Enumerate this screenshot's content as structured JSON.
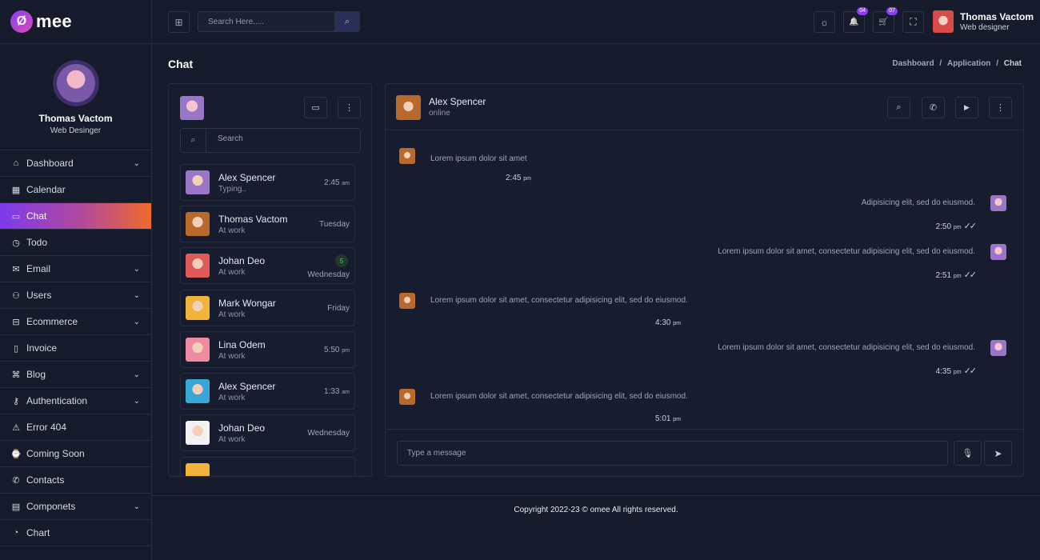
{
  "brand": {
    "logo_glyph": "Ø",
    "name": "mee"
  },
  "profile": {
    "name": "Thomas Vactom",
    "role": "Web Desinger"
  },
  "sidebar": {
    "items": [
      {
        "label": "Dashboard",
        "icon": "home-icon",
        "glyph": "⌂",
        "chevron": true
      },
      {
        "label": "Calendar",
        "icon": "calendar-icon",
        "glyph": "▦",
        "chevron": false
      },
      {
        "label": "Chat",
        "icon": "chat-icon",
        "glyph": "▭",
        "chevron": false,
        "active": true
      },
      {
        "label": "Todo",
        "icon": "clock-icon",
        "glyph": "◷",
        "chevron": false
      },
      {
        "label": "Email",
        "icon": "mail-icon",
        "glyph": "✉",
        "chevron": true
      },
      {
        "label": "Users",
        "icon": "user-icon",
        "glyph": "⚇",
        "chevron": true
      },
      {
        "label": "Ecommerce",
        "icon": "bag-icon",
        "glyph": "⊟",
        "chevron": true
      },
      {
        "label": "Invoice",
        "icon": "file-icon",
        "glyph": "▯",
        "chevron": false
      },
      {
        "label": "Blog",
        "icon": "command-icon",
        "glyph": "⌘",
        "chevron": true
      },
      {
        "label": "Authentication",
        "icon": "key-icon",
        "glyph": "⚷",
        "chevron": true
      },
      {
        "label": "Error 404",
        "icon": "alert-icon",
        "glyph": "⚠",
        "chevron": false
      },
      {
        "label": "Coming Soon",
        "icon": "watch-icon",
        "glyph": "⌚",
        "chevron": false
      },
      {
        "label": "Contacts",
        "icon": "phone-icon",
        "glyph": "✆",
        "chevron": false
      },
      {
        "label": "Componets",
        "icon": "layout-icon",
        "glyph": "▤",
        "chevron": true
      },
      {
        "label": "Chart",
        "icon": "pie-chart-icon",
        "glyph": "◔",
        "chevron": false
      }
    ],
    "chevron_glyph": "⌄"
  },
  "topbar": {
    "search_placeholder": "Search Here.....",
    "grid_glyph": "⊞",
    "search_glyph": "⌕",
    "theme_glyph": "☼",
    "bell_glyph": "🔔",
    "bell_badge": "04",
    "cart_glyph": "🛒",
    "cart_badge": "07",
    "fullscreen_glyph": "⛶",
    "user_name": "Thomas Vactom",
    "user_role": "Web designer"
  },
  "page": {
    "title": "Chat",
    "breadcrumb": [
      "Dashboard",
      "Application",
      "Chat"
    ],
    "separator": "/"
  },
  "contacts": {
    "search_placeholder": "Search",
    "search_glyph": "⌕",
    "chat_glyph": "▭",
    "more_glyph": "⋮",
    "list": [
      {
        "name": "Alex Spencer",
        "status": "Typing..",
        "time": "2:45",
        "time_unit": "am",
        "color": "#9a76c6"
      },
      {
        "name": "Thomas Vactom",
        "status": "At work",
        "time": "Tuesday",
        "time_unit": "",
        "color": "#b86a2c"
      },
      {
        "name": "Johan Deo",
        "status": "At work",
        "time": "Wednesday",
        "time_unit": "",
        "count": "5",
        "color": "#e05a5a"
      },
      {
        "name": "Mark Wongar",
        "status": "At work",
        "time": "Friday",
        "time_unit": "",
        "color": "#f2b33a"
      },
      {
        "name": "Lina Odem",
        "status": "At work",
        "time": "5:50",
        "time_unit": "pm",
        "color": "#f08aa0"
      },
      {
        "name": "Alex Spencer",
        "status": "At work",
        "time": "1:33",
        "time_unit": "am",
        "color": "#3aa6d8"
      },
      {
        "name": "Johan Deo",
        "status": "At work",
        "time": "Wednesday",
        "time_unit": "",
        "color": "#f2f2f2"
      }
    ]
  },
  "chat": {
    "name": "Alex Spencer",
    "status": "online",
    "search_glyph": "⌕",
    "call_glyph": "✆",
    "video_glyph": "▶",
    "more_glyph": "⋮",
    "ticks_glyph": "✓✓",
    "messages": [
      {
        "dir": "in",
        "text": "Lorem ipsum dolor sit amet",
        "time": "2:45",
        "unit": "pm"
      },
      {
        "dir": "out",
        "text": "Adipisicing elit, sed do eiusmod.",
        "time": "2:50",
        "unit": "pm"
      },
      {
        "dir": "out",
        "text": "Lorem ipsum dolor sit amet, consectetur adipisicing elit, sed do eiusmod.",
        "time": "2:51",
        "unit": "pm"
      },
      {
        "dir": "in",
        "text": "Lorem ipsum dolor sit amet, consectetur adipisicing elit, sed do eiusmod.",
        "time": "4:30",
        "unit": "pm"
      },
      {
        "dir": "out",
        "text": "Lorem ipsum dolor sit amet, consectetur adipisicing elit, sed do eiusmod.",
        "time": "4:35",
        "unit": "pm"
      },
      {
        "dir": "in",
        "text": "Lorem ipsum dolor sit amet, consectetur adipisicing elit, sed do eiusmod.",
        "time": "5:01",
        "unit": "pm"
      }
    ],
    "input_placeholder": "Type a message",
    "mic_glyph": "🎙",
    "send_glyph": "➤"
  },
  "footer": {
    "text": "Copyright 2022-23 © omee All rights reserved."
  },
  "colors": {
    "accent_start": "#7c3aed",
    "accent_end": "#f06a2a",
    "background": "#161b2c",
    "badge": "#8b3cf5"
  }
}
